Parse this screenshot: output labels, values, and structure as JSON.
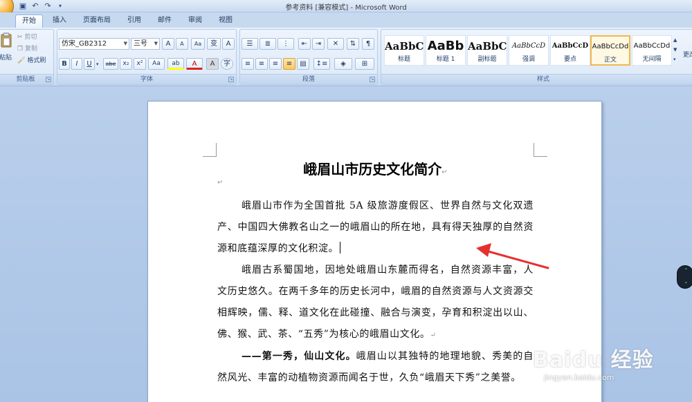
{
  "window": {
    "title": "参考资料 [兼容模式] - Microsoft Word"
  },
  "quick_access": [
    "save-icon",
    "undo-icon",
    "redo-icon"
  ],
  "tabs": [
    {
      "label": "开始",
      "active": true
    },
    {
      "label": "插入"
    },
    {
      "label": "页面布局"
    },
    {
      "label": "引用"
    },
    {
      "label": "邮件"
    },
    {
      "label": "审阅"
    },
    {
      "label": "视图"
    }
  ],
  "clipboard": {
    "label": "剪贴板",
    "paste": "粘贴",
    "cut": "剪切",
    "copy": "复制",
    "format_painter": "格式刷"
  },
  "font": {
    "label": "字体",
    "font_name": "仿宋_GB2312",
    "font_size": "三号",
    "grow": "A",
    "shrink": "A",
    "clear": "Aa",
    "phonetic": "变",
    "border": "A",
    "bold": "B",
    "italic": "I",
    "underline": "U",
    "strike": "abe",
    "subscript": "x₂",
    "superscript": "x²",
    "change_case": "Aa",
    "highlight": "ab",
    "font_color": "A",
    "shading": "A",
    "enclose": "字"
  },
  "paragraph": {
    "label": "段落"
  },
  "styles": {
    "label": "样式",
    "items": [
      {
        "sample": "AaBbC",
        "name": "标题"
      },
      {
        "sample": "AaBb",
        "name": "标题 1"
      },
      {
        "sample": "AaBbC",
        "name": "副标题"
      },
      {
        "sample": "AaBbCcD",
        "name": "强调"
      },
      {
        "sample": "AaBbCcD",
        "name": "要点"
      },
      {
        "sample": "AaBbCcDd",
        "name": "正文"
      },
      {
        "sample": "AaBbCcDd",
        "name": "无间隔"
      }
    ],
    "change_styles": "更改"
  },
  "document": {
    "title": "峨眉山市历史文化简介",
    "para1": "峨眉山市作为全国首批 5A 级旅游度假区、世界自然与文化双遗产、中国四大佛教名山之一的峨眉山的所在地，具有得天独厚的自然资源和底蕴深厚的文化积淀。",
    "para2": "峨眉古系蜀国地，因地处峨眉山东麓而得名，自然资源丰富，人文历史悠久。在两千多年的历史长河中，峨眉的自然资源与人文资源交相辉映，儒、释、道文化在此碰撞、融合与演变，孕育和积淀出以山、佛、猴、武、茶、“五秀”为核心的峨眉山文化。",
    "para3_bold": "——第一秀，仙山文化。",
    "para3_rest": "峨眉山以其独特的地理地貌、秀美的自然风光、丰富的动植物资源而闻名于世，久负“峨眉天下秀”之美誉。"
  },
  "watermark": {
    "brand": "Baidu 经验",
    "url": "jingyan.baidu.com"
  },
  "colors": {
    "arrow": "#e53030",
    "selected_style_border": "#f0b84a",
    "ribbon_bg": "#dbe8f7"
  }
}
